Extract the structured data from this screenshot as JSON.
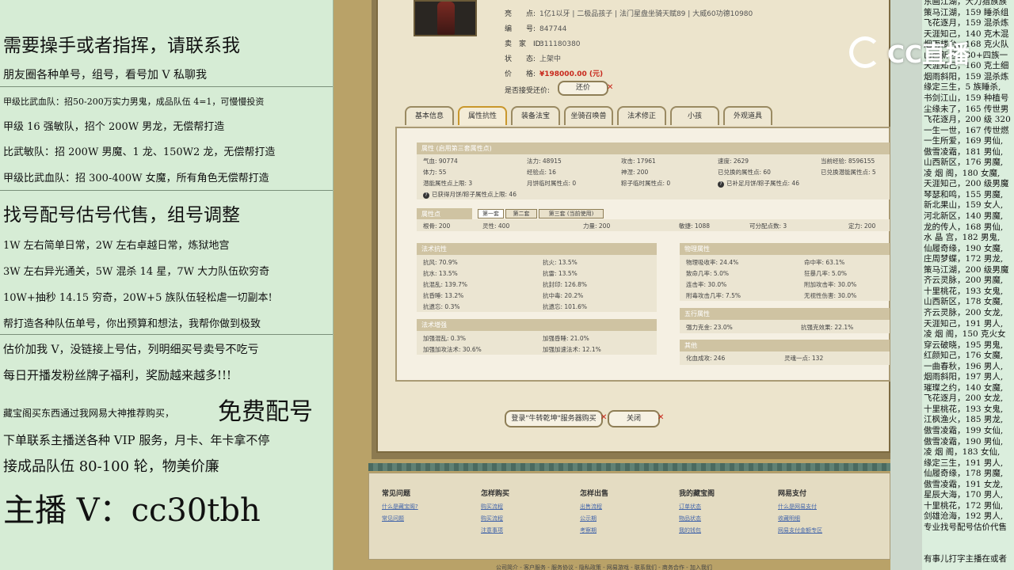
{
  "left_panel": {
    "headline": "需要操手或者指挥，请联系我",
    "line_friends": "朋友圈各种单号，组号，看号加 V 私聊我",
    "line_team1": "甲级比武血队：招50-200万实力男鬼，成品队伍 4=1，可慢慢投资",
    "line_team2": "甲级 16 强敏队，招个 200W 男龙，无偿帮打造",
    "line_team3": "比武敏队：招 200W 男魔、1 龙、150W2 龙，无偿帮打造",
    "line_team4": "甲级比武血队：招 300-400W 女魔，所有角色无偿帮打造",
    "headline2": "找号配号估号代售，组号调整",
    "line_price1": "1W 左右简单日常，2W 左右卓越日常，炼狱地宫",
    "line_price2": "3W 左右异光通关，5W 混杀 14 星，7W 大力队伍砍穷奇",
    "line_price3": "10W+抽秒 14.15 穷奇，20W+5 族队伍轻松虐一切副本!",
    "line_help": "帮打造各种队伍单号，你出预算和想法，我帮你做到极致",
    "line_estimate": "估价加我 V，没链接上号估，列明细买号卖号不吃亏",
    "line_gift": "每日开播发粉丝牌子福利，奖励越来越多!!!",
    "line_buy": "藏宝阁买东西通过我网易大神推荐购买，",
    "free_match": "免费配号",
    "line_vip": "下单联系主播送各种 VIP 服务，月卡、年卡拿不停",
    "line_team5": "接成品队伍 80-100 轮，物美价廉",
    "contact": "主播 V：cc30tbh"
  },
  "game": {
    "info": [
      {
        "key": "亮　　点:",
        "value": "1亿1以牙 | 二极品孩子 | 法门星盘坐骑天赋89 | 大威60功德10980"
      },
      {
        "key": "编　　号:",
        "value": "847744"
      },
      {
        "key": "卖　家　ID:",
        "value": "311180380"
      },
      {
        "key": "状　　态:",
        "value": "上架中"
      },
      {
        "key": "价　　格:",
        "value": "¥198000.00 (元)"
      }
    ],
    "counter_label": "是否接受还价:",
    "counter_button": "还价",
    "tabs": [
      "基本信息",
      "属性抗性",
      "装备法宝",
      "坐骑召唤兽",
      "法术修正",
      "小孩",
      "外观道具"
    ],
    "attr_section": {
      "title": "属性 (启用第三套属性点)",
      "rows": [
        [
          "气血: 90774",
          "法力: 48915",
          "攻击: 17961",
          "速度: 2629",
          "当前经验: 8596155"
        ],
        [
          "体力: 55",
          "经验点: 16",
          "神涅: 200",
          "已兑换的属性点: 60",
          "已兑换潜能属性点: 5"
        ],
        [
          "潜能属性点上限: 3",
          "月饼临时属性点: 0",
          "粽子临时属性点: 0",
          "已补足月饼/粽子属性点: 46",
          ""
        ]
      ],
      "note": "已获得月饼/粽子属性点上限: 46"
    },
    "points_section": {
      "title": "属性点",
      "subtabs": [
        "第一套",
        "第二套",
        "第三套 (当前使用)"
      ],
      "row": [
        "根骨: 200",
        "灵性: 400",
        "力量: 200",
        "敏捷: 1088",
        "可分配点数: 3",
        "定力: 200"
      ]
    },
    "resist_section": {
      "title": "法术抗性",
      "rows": [
        [
          "抗风: 70.9%",
          "抗火: 13.5%"
        ],
        [
          "抗水: 13.5%",
          "抗雷: 13.5%"
        ],
        [
          "抗混乱: 139.7%",
          "抗封印: 126.8%"
        ],
        [
          "抗昏睡: 13.2%",
          "抗中毒: 20.2%"
        ],
        [
          "抗遗忘: 0.3%",
          "抗遗忘: 101.6%"
        ]
      ]
    },
    "boost_section": {
      "title": "法术增强",
      "rows": [
        [
          "加强混乱: 0.3%",
          "加强昏睡: 21.0%"
        ],
        [
          "加强加攻法术: 30.6%",
          "加强加速法术: 12.1%"
        ]
      ]
    },
    "physical_section": {
      "title": "物理属性",
      "rows": [
        [
          "物理吸收率: 24.4%",
          "命中率: 63.1%"
        ],
        [
          "致命几率: 5.0%",
          "狂暴几率: 5.0%"
        ],
        [
          "连击率: 30.0%",
          "附加攻击率: 30.0%"
        ],
        [
          "附毒攻击几率: 7.5%",
          "无视性伤害: 30.0%"
        ]
      ]
    },
    "five_section": {
      "title": "五行属性",
      "rows": [
        [
          "强力克金: 23.0%",
          "抗强克效果: 22.1%"
        ]
      ]
    },
    "other_section": {
      "title": "其他",
      "rows": [
        [
          "化血成攻: 246",
          "灵魂一点: 132"
        ]
      ]
    },
    "login_button": "登录\"牛转乾坤\"服务器购买",
    "close_button": "关闭",
    "footer": {
      "cols": [
        {
          "title": "常见问题",
          "links": [
            "什么是藏宝阁?",
            "常见问题"
          ]
        },
        {
          "title": "怎样购买",
          "links": [
            "购买流程",
            "购买流程",
            "注意事项"
          ]
        },
        {
          "title": "怎样出售",
          "links": [
            "出售流程",
            "公示期",
            "考察期"
          ]
        },
        {
          "title": "我的藏宝阁",
          "links": [
            "订单状态",
            "物品状态",
            "我的钱包"
          ]
        },
        {
          "title": "网易支付",
          "links": [
            "什么是网易支付",
            "收藏明细",
            "网易支付金额专区"
          ]
        }
      ],
      "bottom": "公司简介 - 客户服务 - 服务协议 - 隐私政策 - 网易游戏 - 联系我们 - 商务合作 - 加入我们"
    }
  },
  "chat": [
    "东画江湖，大力猎族族",
    "策马江湖，159 睡杀组",
    "飞花逐月，159 混杀炼",
    "天涯知己，140 克木混",
    "烟雨楼台，168 克火队",
    "山西新区，80+四族一",
    "天涯知己，160 克土细",
    "烟雨斜阳，159 混杀炼",
    "缘定三生，5 族睡杀,",
    "书剑江山，159 种植号",
    "尘缘未了，165 传世男",
    "飞花逐月，200 级 320",
    "一生一世，167 传世燃",
    "一生所爱，169 男仙,",
    "傲雪凌霜，181 男仙,",
    "山西新区，176 男魔,",
    "凌 烟 阁，180 女魔,",
    "天涯知己，200 级男魔",
    "琴瑟和鸣，155 男魔,",
    "新北果山，159 女人,",
    "河北新区，140 男魔,",
    "龙的传人，168 男仙,",
    "水 晶 宫，182 男鬼,",
    "仙履奇缘，190 女魔,",
    "庄周梦蝶，172 男龙,",
    "策马江湖，200 级男魔",
    "齐云灵脉，200 男魔,",
    "十里桃花，193 女鬼,",
    "山西新区，178 女魔,",
    "齐云灵脉，200 女龙,",
    "天涯知己，191 男人,",
    "凌 烟 阁，150 克火女",
    "穿云破晓，195 男鬼,",
    "红颜知己，176 女魔,",
    "一曲春秋，196 男人,",
    "烟雨斜阳，197 男人,",
    "璀璨之约，140 女魔,",
    "飞花逐月，200 女龙,",
    "十里桃花，193 女鬼,",
    "江枫渔火，185 男龙,",
    "傲雪凌霜，199 女仙,",
    "傲雪凌霜，190 男仙,",
    "凌 烟 阁，183 女仙,",
    "缘定三生，191 男人,",
    "仙履奇缘，178 男魔,",
    "傲雪凌霜，191 女龙,",
    "星辰大海，170 男人,",
    "十里桃花，172 男仙,",
    "剑雄沧海，192 男人,",
    "专业找号配号估价代售",
    "有事儿打字主播在或者"
  ],
  "watermark": "CC直播"
}
